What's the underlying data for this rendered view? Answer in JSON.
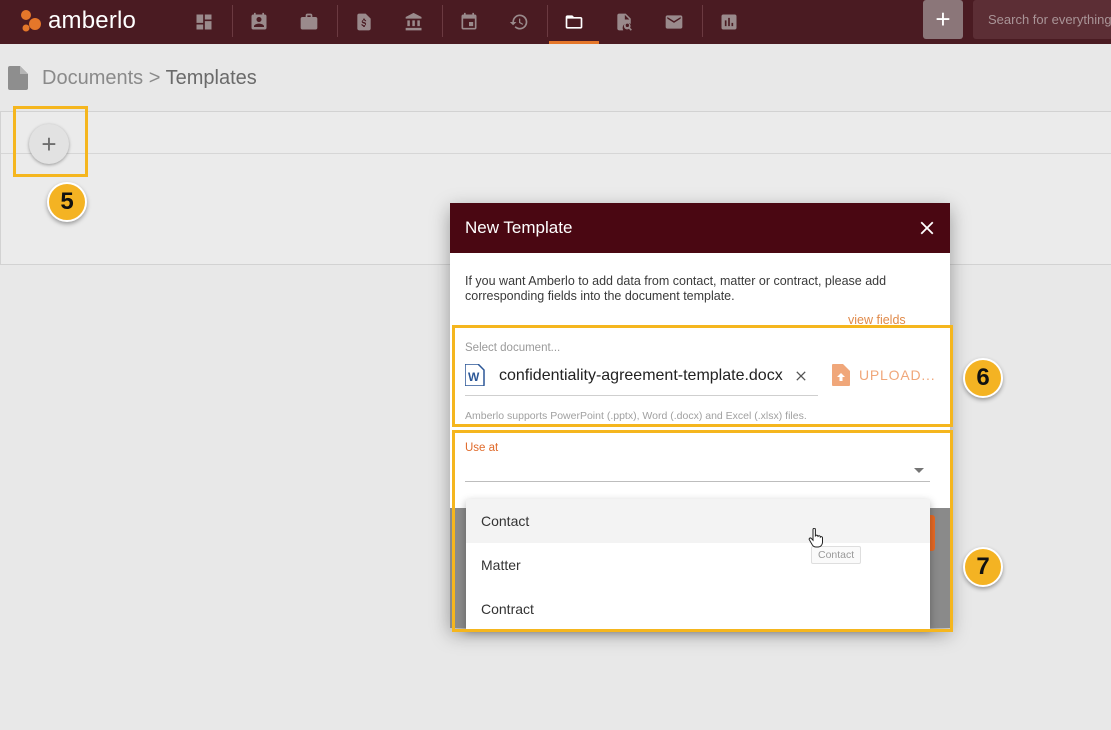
{
  "app": {
    "logo_text": "amberlo"
  },
  "topbar": {
    "nav": [
      {
        "id": "dashboard",
        "icon": "dashboard-icon"
      },
      {
        "id": "contacts",
        "icon": "contacts-icon"
      },
      {
        "id": "matters",
        "icon": "briefcase-icon"
      },
      {
        "id": "billing",
        "icon": "invoice-icon"
      },
      {
        "id": "accounts",
        "icon": "bank-icon"
      },
      {
        "id": "calendar",
        "icon": "calendar-icon"
      },
      {
        "id": "time",
        "icon": "history-icon"
      },
      {
        "id": "documents",
        "icon": "folder-icon",
        "active": true
      },
      {
        "id": "contracts",
        "icon": "contract-search-icon"
      },
      {
        "id": "mail",
        "icon": "mail-icon"
      },
      {
        "id": "reports",
        "icon": "reports-icon"
      }
    ],
    "add_label": "+",
    "search_placeholder": "Search for everything..."
  },
  "page": {
    "breadcrumb_root": "Documents",
    "breadcrumb_sep": " > ",
    "breadcrumb_current": "Templates",
    "fab_label": "+"
  },
  "annotations": {
    "badge_5": "5",
    "badge_6": "6",
    "badge_7": "7",
    "highlight_color": "#f5b61e"
  },
  "dialog": {
    "title": "New Template",
    "info": "If you want Amberlo to add data from contact, matter or contract, please add corresponding fields into the document template.",
    "view_fields": "view fields",
    "select_label": "Select document...",
    "filename": "confidentiality-agreement-template.docx",
    "upload_label": "UPLOAD...",
    "support_hint": "Amberlo supports PowerPoint (.pptx), Word (.docx) and Excel (.xlsx) files.",
    "use_at_label": "Use at",
    "use_at_value": "",
    "options": [
      "Contact",
      "Matter",
      "Contract"
    ],
    "tooltip": "Contact"
  },
  "colors": {
    "topbar": "#4a1b22",
    "dialog_header": "#4a0712",
    "accent": "#e5772a"
  }
}
